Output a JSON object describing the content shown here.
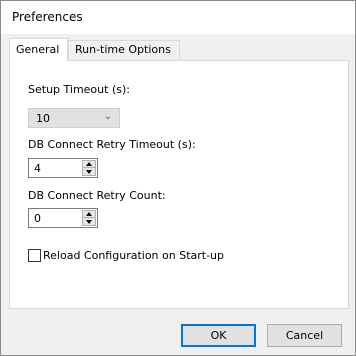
{
  "window": {
    "title": "Preferences"
  },
  "tabs": [
    {
      "label": "General",
      "active": true
    },
    {
      "label": "Run-time Options",
      "active": false
    }
  ],
  "general": {
    "setup_timeout": {
      "label": "Setup Timeout (s):",
      "value": "10"
    },
    "db_retry_timeout": {
      "label": "DB Connect Retry Timeout (s):",
      "value": "4"
    },
    "db_retry_count": {
      "label": "DB Connect Retry Count:",
      "value": "0"
    },
    "reload_config": {
      "label": "Reload Configuration on Start-up",
      "checked": false
    }
  },
  "buttons": {
    "ok": "OK",
    "cancel": "Cancel"
  },
  "colors": {
    "default_button_border": "#0078d7",
    "panel_bg": "#ffffff",
    "window_bg": "#f0f0f0"
  }
}
